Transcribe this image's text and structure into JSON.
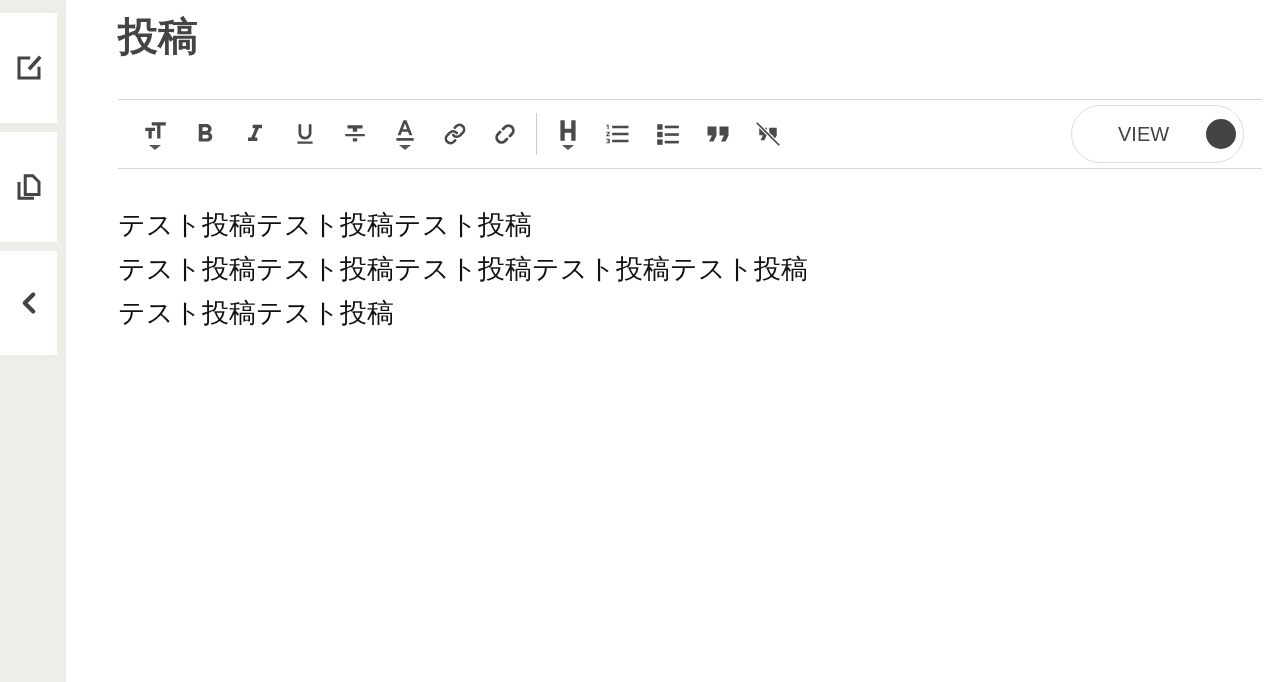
{
  "page": {
    "title": "投稿"
  },
  "editor": {
    "view_toggle": {
      "label": "VIEW",
      "on": true
    },
    "lines": [
      "テスト投稿テスト投稿テスト投稿",
      "テスト投稿テスト投稿テスト投稿テスト投稿テスト投稿",
      "テスト投稿テスト投稿"
    ]
  }
}
